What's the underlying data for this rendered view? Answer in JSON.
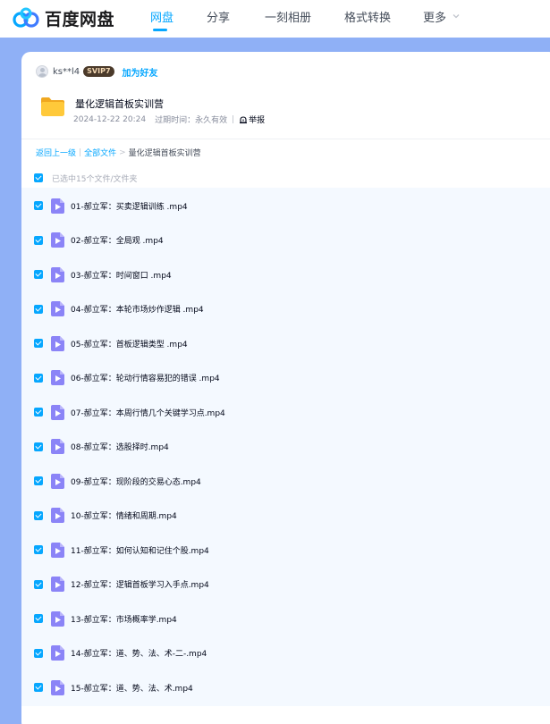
{
  "header": {
    "logo_text": "百度网盘",
    "nav": [
      {
        "label": "网盘",
        "active": true
      },
      {
        "label": "分享",
        "active": false
      },
      {
        "label": "一刻相册",
        "active": false
      },
      {
        "label": "格式转换",
        "active": false
      },
      {
        "label": "更多",
        "active": false
      }
    ]
  },
  "share": {
    "username": "ks**l4",
    "vip_badge": "SVIP7",
    "add_friend": "加为好友",
    "title": "量化逻辑首板实训营",
    "date": "2024-12-22 20:24",
    "expire_label": "过期时间：",
    "expire_value": "永久有效",
    "report": "举报"
  },
  "breadcrumb": {
    "back": "返回上一级",
    "sep": "|",
    "all": "全部文件",
    "arrow": ">",
    "current": "量化逻辑首板实训营"
  },
  "selection": {
    "text": "已选中15个文件/文件夹"
  },
  "files": [
    "01-郝立军：买卖逻辑训练 .mp4",
    "02-郝立军：全局观 .mp4",
    "03-郝立军：时间窗口 .mp4",
    "04-郝立军：本轮市场炒作逻辑 .mp4",
    "05-郝立军：首板逻辑类型 .mp4",
    "06-郝立军：轮动行情容易犯的错误 .mp4",
    "07-郝立军：本周行情几个关键学习点.mp4",
    "08-郝立军：选股择时.mp4",
    "09-郝立军：现阶段的交易心态.mp4",
    "10-郝立军：情绪和周期.mp4",
    "11-郝立军：如何认知和记住个股.mp4",
    "12-郝立军：逻辑首板学习入手点.mp4",
    "13-郝立军：市场概率学.mp4",
    "14-郝立军：道、势、法、术-二-.mp4",
    "15-郝立军：道、势、法、术.mp4"
  ],
  "colors": {
    "accent": "#06a7ff",
    "page_background": "#8fb0f6",
    "list_background": "#f4f9ff",
    "video_icon": "#8b84f7",
    "folder_icon": "#ffc93a"
  },
  "icons": {
    "logo": "baidu-netdisk-logo-icon",
    "folder": "folder-icon",
    "video": "video-file-icon",
    "checkbox": "checkbox-checked-icon",
    "report": "report-icon",
    "more": "chevron-down-icon"
  }
}
